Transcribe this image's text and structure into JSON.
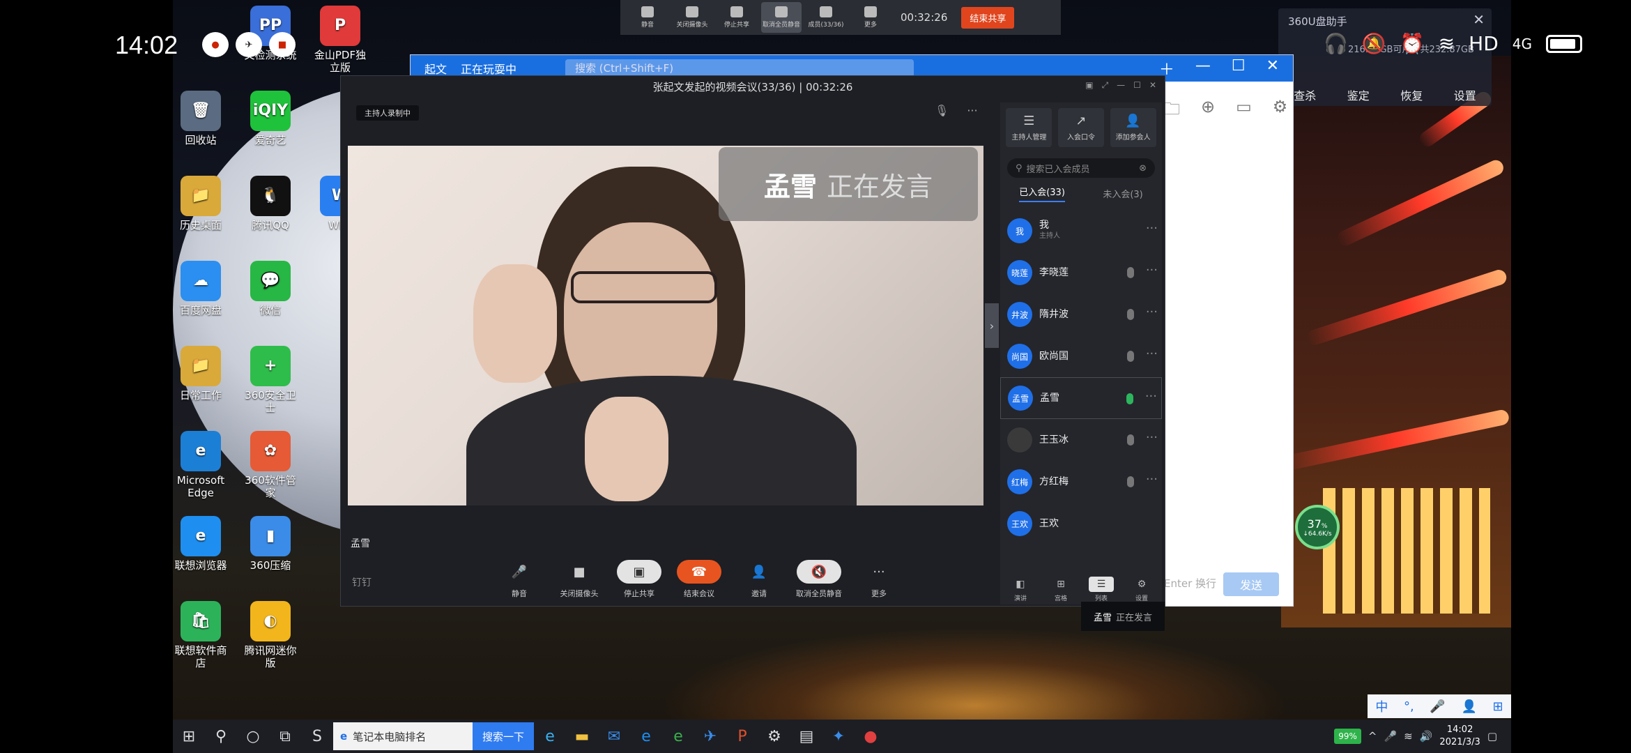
{
  "status_bar": {
    "time": "14:02",
    "network": "HD",
    "signal": "4G"
  },
  "desktop_icons": [
    {
      "label": "回收站",
      "glyph": "🗑",
      "color": "#5a6b82"
    },
    {
      "label": "爱奇艺",
      "glyph": "iQIY",
      "color": "#1fc23b"
    },
    {
      "label": "历史桌面",
      "glyph": "📁",
      "color": "#d9a93a"
    },
    {
      "label": "腾讯QQ",
      "glyph": "🐧",
      "color": "#111"
    },
    {
      "label": "百度网盘",
      "glyph": "☁",
      "color": "#2a8ff0"
    },
    {
      "label": "微信",
      "glyph": "💬",
      "color": "#27b745"
    },
    {
      "label": "日常工作",
      "glyph": "📁",
      "color": "#d9a93a"
    },
    {
      "label": "360安全卫士",
      "glyph": "+",
      "color": "#2ebd4a"
    },
    {
      "label": "Microsoft Edge",
      "glyph": "e",
      "color": "#1c7fd6"
    },
    {
      "label": "360软件管家",
      "glyph": "✿",
      "color": "#e65a35"
    },
    {
      "label": "联想浏览器",
      "glyph": "e",
      "color": "#1e8ff0"
    },
    {
      "label": "360压缩",
      "glyph": "▮",
      "color": "#3a8ce8"
    },
    {
      "label": "联想软件商店",
      "glyph": "🛍",
      "color": "#2cb35a"
    },
    {
      "label": "腾讯网迷你版",
      "glyph": "◐",
      "color": "#f2b51c"
    },
    {
      "label": "文检测系统",
      "glyph": "PP",
      "color": "#3a6ed8"
    },
    {
      "label": "金山PDF独立版",
      "glyph": "P",
      "color": "#e03a3a"
    },
    {
      "label": "WPS",
      "glyph": "W",
      "color": "#2a7ff0"
    }
  ],
  "meeting_toolbar": {
    "buttons": [
      {
        "label": "静音"
      },
      {
        "label": "关闭摄像头"
      },
      {
        "label": "停止共享"
      },
      {
        "label": "取消全员静音"
      },
      {
        "label": "成员(33/36)"
      },
      {
        "label": "更多"
      }
    ],
    "timer": "00:32:26",
    "end_label": "结束共享"
  },
  "u360": {
    "title": "360U盘助手",
    "info": "216.66GB可用，共232.87GB",
    "actions": [
      "查杀",
      "鉴定",
      "恢复",
      "设置"
    ]
  },
  "chat_window": {
    "name": "起文",
    "status": "正在玩耍中",
    "search_placeholder": "搜索 (Ctrl+Shift+F)",
    "send_hint": "Enter 换行",
    "send_label": "发送"
  },
  "meeting": {
    "title": "张起文发起的视频会议(33/36) | 00:32:26",
    "recording_badge": "主持人录制中",
    "speaker_name": "孟雪",
    "speaking_text": "正在发言",
    "video_label": "孟雪",
    "logo": "钉钉",
    "controls": [
      {
        "label": "静音",
        "icon": "🎤",
        "style": ""
      },
      {
        "label": "关闭摄像头",
        "icon": "■",
        "style": ""
      },
      {
        "label": "停止共享",
        "icon": "▣",
        "style": "light"
      },
      {
        "label": "结束会议",
        "icon": "☎",
        "style": "red"
      },
      {
        "label": "邀请",
        "icon": "👤",
        "style": ""
      },
      {
        "label": "取消全员静音",
        "icon": "🔇",
        "style": "light"
      },
      {
        "label": "更多",
        "icon": "···",
        "style": ""
      }
    ]
  },
  "participants": {
    "top_buttons": [
      {
        "label": "主持人管理",
        "icon": "☰"
      },
      {
        "label": "入会口令",
        "icon": "↗"
      },
      {
        "label": "添加参会人",
        "icon": "👤"
      }
    ],
    "search_placeholder": "搜索已入会成员",
    "tab_joined": "已入会(33)",
    "tab_not_joined": "未入会(3)",
    "list": [
      {
        "avatar": "我",
        "name": "我",
        "sub": "主持人",
        "mic": "none",
        "dark": false
      },
      {
        "avatar": "晓莲",
        "name": "李晓莲",
        "sub": "",
        "mic": "gray",
        "dark": false
      },
      {
        "avatar": "井波",
        "name": "隋井波",
        "sub": "",
        "mic": "gray",
        "dark": false
      },
      {
        "avatar": "尚国",
        "name": "欧尚国",
        "sub": "",
        "mic": "gray",
        "dark": false
      },
      {
        "avatar": "孟雪",
        "name": "孟雪",
        "sub": "",
        "mic": "green",
        "dark": false
      },
      {
        "avatar": "",
        "name": "王玉冰",
        "sub": "",
        "mic": "gray",
        "dark": true
      },
      {
        "avatar": "红梅",
        "name": "方红梅",
        "sub": "",
        "mic": "gray",
        "dark": false
      },
      {
        "avatar": "王欢",
        "name": "王欢",
        "sub": "",
        "mic": "none",
        "dark": false
      }
    ],
    "speaking_tip_name": "孟雪",
    "speaking_tip_text": "正在发言",
    "layout_buttons": [
      {
        "label": "演讲",
        "on": false
      },
      {
        "label": "宫格",
        "on": false
      },
      {
        "label": "列表",
        "on": true
      },
      {
        "label": "设置",
        "on": false
      }
    ]
  },
  "net_widget": {
    "percent": "37",
    "unit": "%",
    "speed": "↓64.6K/s"
  },
  "taskbar": {
    "search_text": "笔记本电脑排名",
    "search_button": "搜索一下",
    "battery": "99%",
    "time": "14:02",
    "date": "2021/3/3",
    "ime": [
      "中",
      "°,",
      "🎤",
      "👤",
      "⊞"
    ]
  }
}
